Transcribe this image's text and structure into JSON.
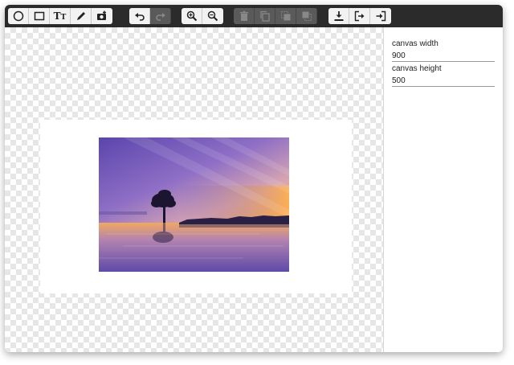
{
  "toolbar": {
    "groups": [
      [
        {
          "name": "circle-tool-button",
          "icon": "circle-icon",
          "enabled": true
        },
        {
          "name": "rectangle-tool-button",
          "icon": "square-icon",
          "enabled": true
        },
        {
          "name": "text-tool-button",
          "icon": "text-icon",
          "enabled": true
        },
        {
          "name": "pencil-tool-button",
          "icon": "pencil-icon",
          "enabled": true
        },
        {
          "name": "image-tool-button",
          "icon": "camera-plus-icon",
          "enabled": true
        }
      ],
      [
        {
          "name": "undo-button",
          "icon": "undo-icon",
          "enabled": true
        },
        {
          "name": "redo-button",
          "icon": "redo-icon",
          "enabled": false
        }
      ],
      [
        {
          "name": "zoom-in-button",
          "icon": "zoom-in-icon",
          "enabled": true
        },
        {
          "name": "zoom-out-button",
          "icon": "zoom-out-icon",
          "enabled": true
        }
      ],
      [
        {
          "name": "delete-button",
          "icon": "trash-icon",
          "enabled": false
        },
        {
          "name": "duplicate-button",
          "icon": "copy-icon",
          "enabled": false
        },
        {
          "name": "bring-forward-button",
          "icon": "bring-forward-icon",
          "enabled": false
        },
        {
          "name": "send-backward-button",
          "icon": "send-backward-icon",
          "enabled": false
        }
      ],
      [
        {
          "name": "download-button",
          "icon": "download-icon",
          "enabled": true
        },
        {
          "name": "export-button",
          "icon": "sign-out-icon",
          "enabled": true
        },
        {
          "name": "import-button",
          "icon": "sign-in-icon",
          "enabled": true
        }
      ]
    ]
  },
  "properties": {
    "width_label": "canvas width",
    "width_value": "900",
    "height_label": "canvas height",
    "height_value": "500"
  },
  "colors": {
    "toolbar_bg": "#2b2b2b",
    "button_bg": "#f2f2f2",
    "sky_top": "#6b4fb5",
    "sunset": "#f6a04d"
  }
}
